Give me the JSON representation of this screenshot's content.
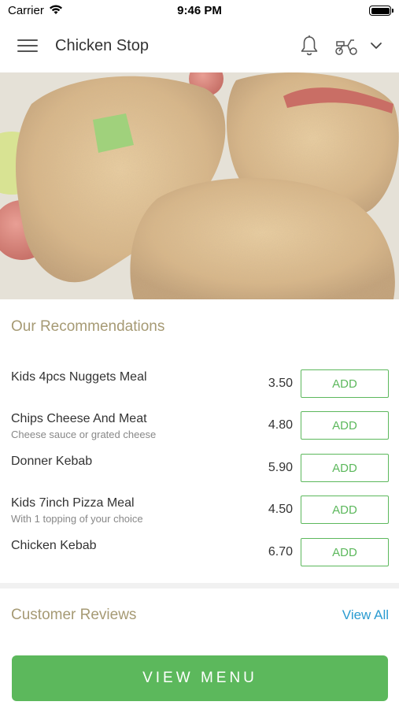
{
  "status_bar": {
    "carrier": "Carrier",
    "time": "9:46 PM"
  },
  "nav": {
    "title": "Chicken Stop",
    "icons": [
      "hamburger-menu-icon",
      "bell-icon",
      "scooter-icon",
      "chevron-down-icon"
    ]
  },
  "hero": {
    "image": "fried-chicken-photo"
  },
  "recommendations": {
    "title": "Our Recommendations",
    "items": [
      {
        "name": "Kids 4pcs Nuggets Meal",
        "description": "",
        "price": "3.50",
        "action": "ADD"
      },
      {
        "name": "Chips Cheese And Meat",
        "description": "Cheese sauce or grated cheese",
        "price": "4.80",
        "action": "ADD"
      },
      {
        "name": "Donner Kebab",
        "description": "",
        "price": "5.90",
        "action": "ADD"
      },
      {
        "name": "Kids 7inch Pizza Meal",
        "description": "With 1 topping of your choice",
        "price": "4.50",
        "action": "ADD"
      },
      {
        "name": "Chicken Kebab",
        "description": "",
        "price": "6.70",
        "action": "ADD"
      }
    ]
  },
  "reviews": {
    "title": "Customer Reviews",
    "view_all": "View All"
  },
  "footer": {
    "view_menu": "VIEW MENU"
  },
  "colors": {
    "accent_green": "#5cb85c",
    "section_title": "#a69a74",
    "link_blue": "#2a9bd1"
  }
}
